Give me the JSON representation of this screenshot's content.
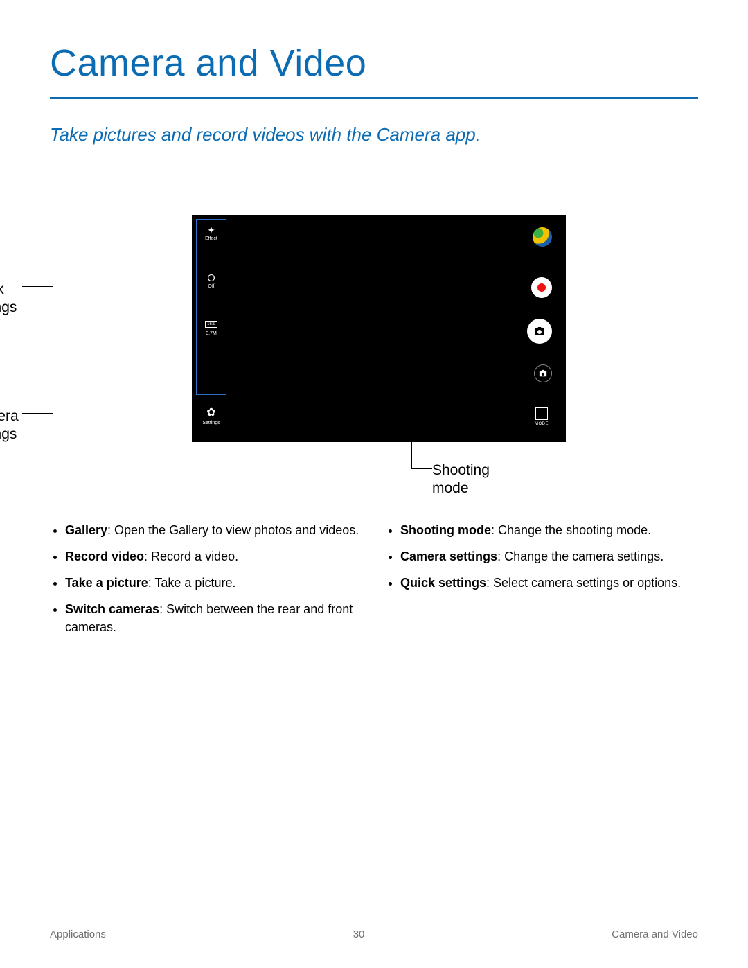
{
  "title": "Camera and Video",
  "tagline": "Take pictures and record videos with the Camera app.",
  "phone": {
    "qs": {
      "effect": {
        "icon": "✦",
        "label": "Effect"
      },
      "timer": {
        "icon": "⭘",
        "label": "Off"
      },
      "ratio": {
        "box": "16:9",
        "mp": "3.7M"
      }
    },
    "settings_label": "Settings",
    "mode_label": "MODE"
  },
  "callouts": {
    "quick": "Quick\nsettings",
    "camset": "Camera\nsettings",
    "gallery": "Gallery",
    "record": "Record video",
    "take": "Take a picture",
    "switch": "Switch\ncameras",
    "mode": "Shooting\nmode"
  },
  "bullets_left": [
    {
      "b": "Gallery",
      "t": ": Open the Gallery to view photos and videos."
    },
    {
      "b": "Record video",
      "t": ": Record a video."
    },
    {
      "b": "Take a picture",
      "t": ": Take a picture."
    },
    {
      "b": "Switch cameras",
      "t": ": Switch between the rear and front cameras."
    }
  ],
  "bullets_right": [
    {
      "b": "Shooting mode",
      "t": ": Change the shooting mode."
    },
    {
      "b": "Camera settings",
      "t": ": Change the camera settings."
    },
    {
      "b": "Quick settings",
      "t": ": Select camera settings or options."
    }
  ],
  "footer": {
    "left": "Applications",
    "center": "30",
    "right": "Camera and Video"
  }
}
